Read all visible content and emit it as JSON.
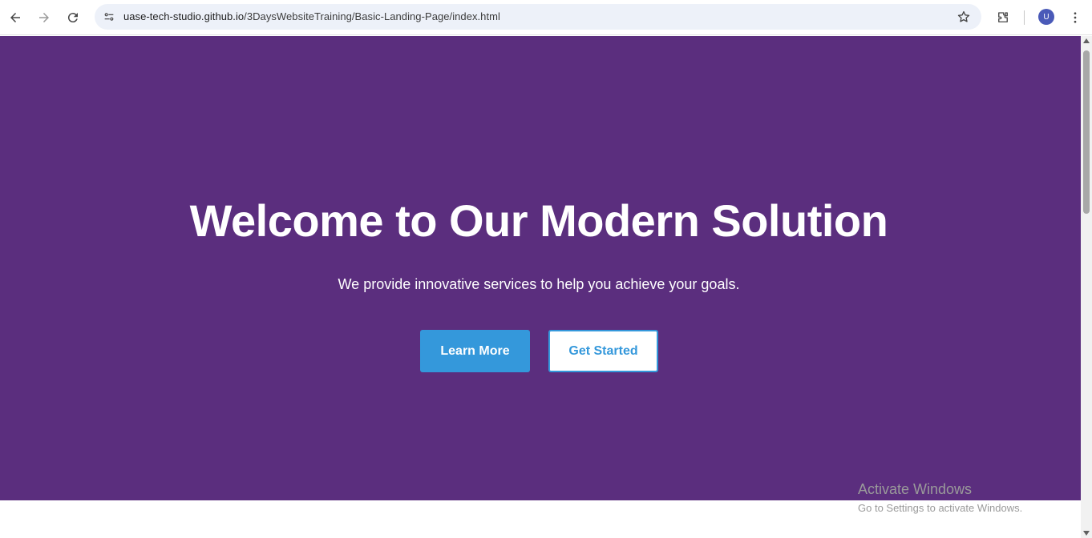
{
  "browser": {
    "url_host": "uase-tech-studio.github.io",
    "url_path": "/3DaysWebsiteTraining/Basic-Landing-Page/index.html",
    "profile_initial": "U",
    "icons": [
      "back-icon",
      "forward-icon",
      "reload-icon",
      "site-info-icon",
      "bookmark-star-icon",
      "extensions-icon",
      "menu-icon"
    ]
  },
  "hero": {
    "title": "Welcome to Our Modern Solution",
    "subtitle": "We provide innovative services to help you achieve your goals.",
    "primary_button": "Learn More",
    "secondary_button": "Get Started"
  },
  "watermark": {
    "title": "Activate Windows",
    "subtitle": "Go to Settings to activate Windows."
  },
  "colors": {
    "hero_bg": "#5b2e7e",
    "accent": "#3498db",
    "text_on_hero": "#ffffff"
  }
}
